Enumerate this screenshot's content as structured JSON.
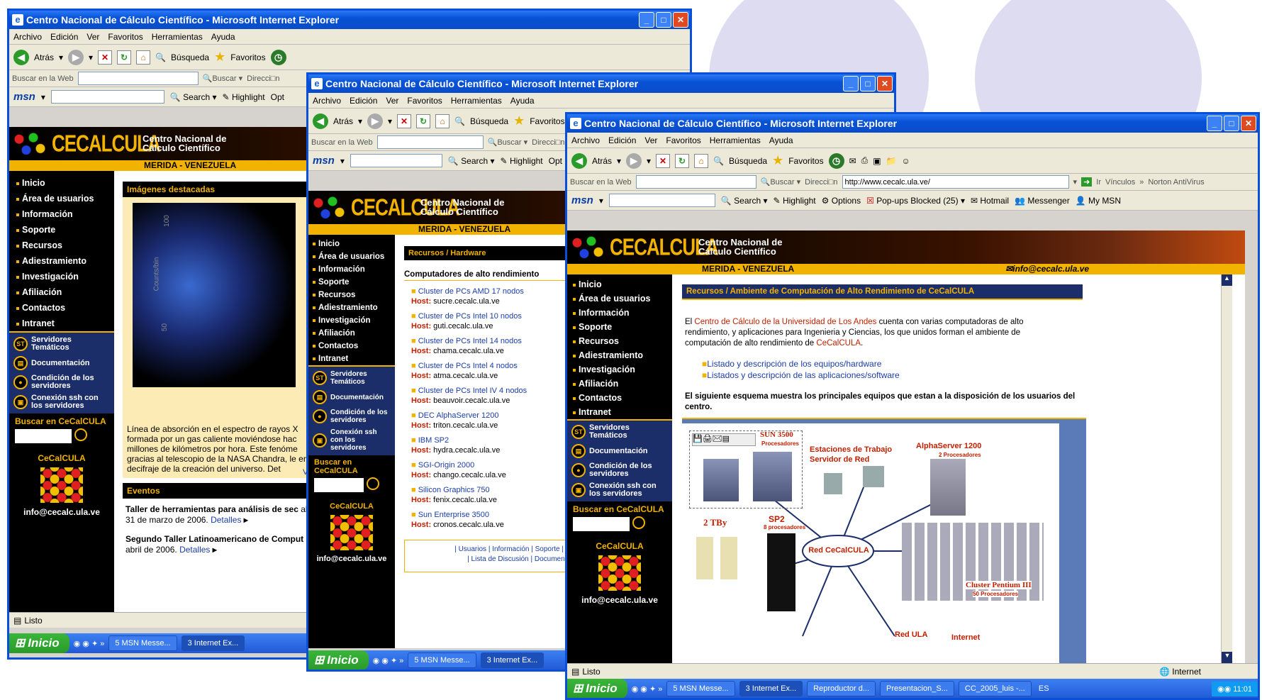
{
  "windows": [
    {
      "title": "Centro Nacional de Cálculo Científico - Microsoft Internet Explorer",
      "menu": [
        "Archivo",
        "Edición",
        "Ver",
        "Favoritos",
        "Herramientas",
        "Ayuda"
      ],
      "back": "Atrás",
      "search": "Búsqueda",
      "favorites": "Favoritos",
      "search_web_label": "Buscar en la Web",
      "buscar_btn": "Buscar",
      "direccion": "Direcci□n",
      "msn_search": "Search",
      "highlight": "Highlight",
      "options_partial": "Opt",
      "status": "Listo"
    },
    {
      "title": "Centro Nacional de Cálculo Científico - Microsoft Internet Explorer",
      "menu": [
        "Archivo",
        "Edición",
        "Ver",
        "Favoritos",
        "Herramientas",
        "Ayuda"
      ],
      "back": "Atrás",
      "search": "Búsqueda",
      "favorites": "Favoritos",
      "search_web_label": "Buscar en la Web",
      "buscar_btn": "Buscar",
      "direccion": "Direcci□n",
      "msn_search": "Search",
      "highlight": "Highlight",
      "options_partial": "Opt"
    },
    {
      "title": "Centro Nacional de Cálculo Científico - Microsoft Internet Explorer",
      "menu": [
        "Archivo",
        "Edición",
        "Ver",
        "Favoritos",
        "Herramientas",
        "Ayuda"
      ],
      "back": "Atrás",
      "search": "Búsqueda",
      "favorites": "Favoritos",
      "search_web_label": "Buscar en la Web",
      "buscar_btn": "Buscar",
      "direccion": "Direcci□n",
      "address": "http://www.cecalc.ula.ve/",
      "ir": "Ir",
      "vinculos": "Vínculos",
      "norton": "Norton AntiVirus",
      "msn_search": "Search",
      "highlight": "Highlight",
      "options": "Options",
      "popups": "Pop-ups Blocked (25)",
      "hotmail": "Hotmail",
      "messenger": "Messenger",
      "mymsn": "My MSN",
      "status": "Listo",
      "zone": "Internet"
    }
  ],
  "site": {
    "logo": "CECALCULA",
    "subtitle1": "Centro Nacional de",
    "subtitle2": "Cálculo Científico",
    "location": "MERIDA - VENEZUELA",
    "email_banner": "info@cecalc.ula.ve",
    "nav": [
      "Inicio",
      "Área de usuarios",
      "Información",
      "Soporte",
      "Recursos",
      "Adiestramiento",
      "Investigación",
      "Afiliación",
      "Contactos",
      "Intranet"
    ],
    "services": [
      "Servidores Temáticos",
      "Documentación",
      "Condición de los servidores",
      "Conexión ssh con los servidores"
    ],
    "search_label": "Buscar en CeCalCULA",
    "ce_label": "CeCalCULA",
    "email_left": "info@cecalc.ula.ve"
  },
  "page1": {
    "featured_title": "Imágenes destacadas",
    "axis_100": "100",
    "axis_50": "50",
    "axis_label": "Counts/bin",
    "caption": "Línea de absorción en el espectro de rayos X formada por un gas caliente moviéndose hac millones de kilómetros por hora. Este fenóme gracias al telescopio de la NASA Chandra, le en el decifraje de la creación del universo. Det",
    "ver": "Ver i",
    "events_title": "Eventos",
    "event1": "Taller de herramientas para análisis de sec",
    "event1b": "al 31 de marzo de 2006.",
    "event1_more": "Detalles",
    "event2": "Segundo Taller Latinoamericano de Comput",
    "event2b": "de abril de 2006.",
    "event2_more": "Detalles"
  },
  "page2": {
    "section": "Recursos / Hardware",
    "heading": "Computadores de alto rendimiento",
    "host_label": "Host:",
    "items": [
      {
        "name": "Cluster de PCs AMD 17 nodos",
        "host": "sucre.cecalc.ula.ve"
      },
      {
        "name": "Cluster de PCs Intel 10 nodos",
        "host": "guti.cecalc.ula.ve"
      },
      {
        "name": "Cluster de PCs Intel 14 nodos",
        "host": "chama.cecalc.ula.ve"
      },
      {
        "name": "Cluster de PCs Intel 4 nodos",
        "host": "atma.cecalc.ula.ve"
      },
      {
        "name": "Cluster de PCs Intel IV 4 nodos",
        "host": "beauvoir.cecalc.ula.ve"
      },
      {
        "name": "DEC AlphaServer 1200",
        "host": "triton.cecalc.ula.ve"
      },
      {
        "name": "IBM SP2",
        "host": "hydra.cecalc.ula.ve"
      },
      {
        "name": "SGI-Origin 2000",
        "host": "chango.cecalc.ula.ve"
      },
      {
        "name": "Silicon Graphics 750",
        "host": "fenix.cecalc.ula.ve"
      },
      {
        "name": "Sun Enterprise 3500",
        "host": "cronos.cecalc.ula.ve"
      }
    ],
    "footer1": "| Usuarios | Información | Soporte | R",
    "footer2": "| Lista de Discusión | Documenta"
  },
  "page3": {
    "section": "Recursos / Ambiente de Computación de Alto Rendimiento de CeCalCULA",
    "p1_a": "El ",
    "p1_link": "Centro de Cálculo de la Universidad de Los Andes",
    "p1_b": " cuenta con varias computadoras de alto rendimiento, y aplicaciones para Ingenieria y Ciencias, los que unidos forman el ambiente de computación de alto rendimiento de ",
    "p1_c": "CeCalCULA",
    "link1": "Listado y descripción de los equipos/hardware",
    "link2": "Listados y descripción de las aplicaciones/software",
    "p2": "El siguiente esquema muestra los principales equipos que estan a la disposición de los usuarios del centro.",
    "diagram": {
      "sun": "SUN 3500",
      "sun_sub": "Procesadores",
      "workstations1": "Estaciones de Trabajo",
      "workstations2": "Servidor de Red",
      "alpha": "AlphaServer 1200",
      "alpha_sub": "2 Procesadores",
      "tby": "2 TBy",
      "sp2": "SP2",
      "sp2_sub": "8 procesadores",
      "red": "Red CeCalCULA",
      "cluster": "Cluster Pentium III",
      "cluster_sub": "50 Procesadores",
      "redula": "Red ULA",
      "internet": "Internet"
    }
  },
  "taskbars": [
    {
      "start": "Inicio",
      "items": [
        "5 MSN Messe...",
        "3 Internet Ex..."
      ]
    },
    {
      "start": "Inicio",
      "items": [
        "5 MSN Messe...",
        "3 Internet Ex..."
      ]
    },
    {
      "start": "Inicio",
      "items": [
        "5 MSN Messe...",
        "3 Internet Ex...",
        "Reproductor d...",
        "Presentacion_S...",
        "CC_2005_luis -..."
      ],
      "lang": "ES",
      "clock": "11:01"
    }
  ]
}
